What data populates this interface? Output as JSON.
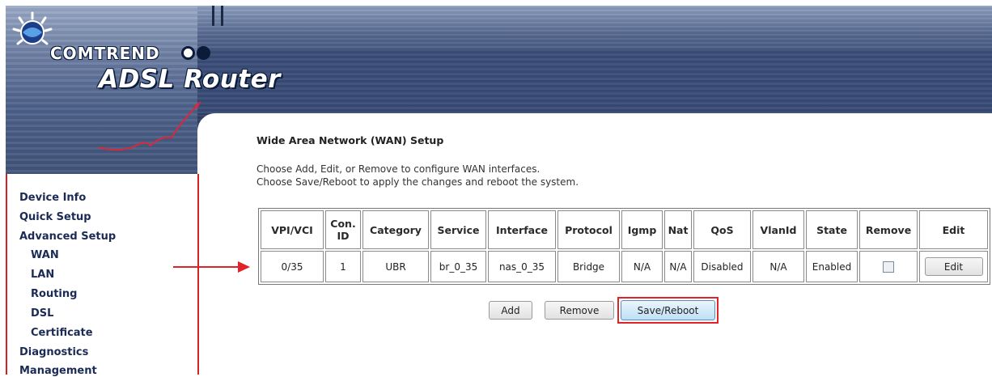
{
  "header": {
    "brand": "COMTREND",
    "product": "ADSL Router"
  },
  "sidebar": {
    "items": [
      {
        "label": "Device Info"
      },
      {
        "label": "Quick Setup"
      },
      {
        "label": "Advanced Setup"
      },
      {
        "label": "WAN"
      },
      {
        "label": "LAN"
      },
      {
        "label": "Routing"
      },
      {
        "label": "DSL"
      },
      {
        "label": "Certificate"
      },
      {
        "label": "Diagnostics"
      },
      {
        "label": "Management"
      }
    ]
  },
  "main": {
    "title": "Wide Area Network (WAN) Setup",
    "desc1": "Choose Add, Edit, or Remove to configure WAN interfaces.",
    "desc2": "Choose Save/Reboot to apply the changes and reboot the system.",
    "table": {
      "headers": [
        "VPI/VCI",
        "Con. ID",
        "Category",
        "Service",
        "Interface",
        "Protocol",
        "Igmp",
        "Nat",
        "QoS",
        "VlanId",
        "State",
        "Remove",
        "Edit"
      ],
      "rows": [
        {
          "vpi_vci": "0/35",
          "con_id": "1",
          "category": "UBR",
          "service": "br_0_35",
          "interface": "nas_0_35",
          "protocol": "Bridge",
          "igmp": "N/A",
          "nat": "N/A",
          "qos": "Disabled",
          "vlan_id": "N/A",
          "state": "Enabled",
          "remove_checked": false,
          "edit_label": "Edit"
        }
      ]
    },
    "buttons": {
      "add": "Add",
      "remove": "Remove",
      "save_reboot": "Save/Reboot"
    }
  },
  "colors": {
    "highlight": "#e0222a",
    "sidebar_border": "#d42323",
    "nav_text": "#1c2b55"
  }
}
